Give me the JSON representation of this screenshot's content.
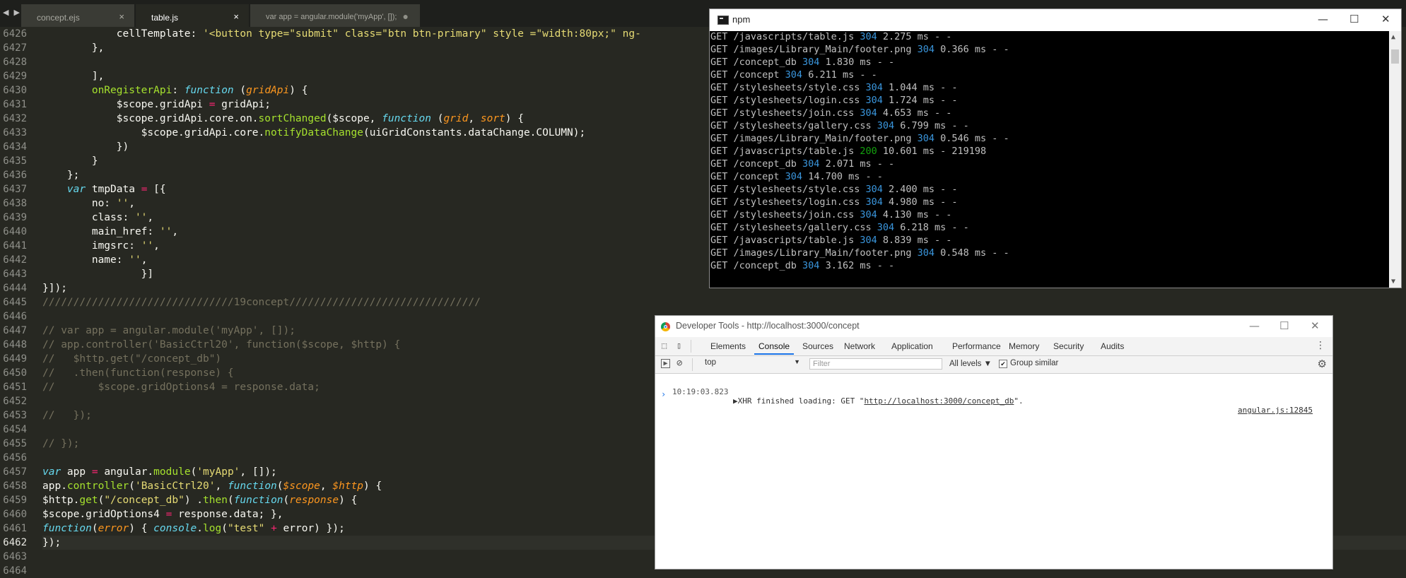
{
  "tabs": {
    "nav": "◀ ▶",
    "items": [
      {
        "label": "concept.ejs",
        "close": "×"
      },
      {
        "label": "table.js",
        "close": "×"
      },
      {
        "label": "var app = angular.module('myApp', []);",
        "close": "●"
      }
    ]
  },
  "editor": {
    "line_numbers": [
      "6426",
      "6427",
      "6428",
      "6429",
      "6430",
      "6431",
      "6432",
      "6433",
      "6434",
      "6435",
      "6436",
      "6437",
      "6438",
      "6439",
      "6440",
      "6441",
      "6442",
      "6443",
      "6444",
      "6445",
      "6446",
      "6447",
      "6448",
      "6449",
      "6450",
      "6451",
      "6452",
      "6453",
      "6454",
      "6455",
      "6456",
      "6457",
      "6458",
      "6459",
      "6460",
      "6461",
      "6462",
      "6463",
      "6464"
    ],
    "current_line": "6462",
    "lines": [
      [
        {
          "t": "            cellTemplate: ",
          "c": ""
        },
        {
          "t": "'<button type=\"submit\" class=\"btn btn-primary\" style =\"width:80px;\" ng-",
          "c": "str"
        }
      ],
      [
        {
          "t": "        },",
          "c": ""
        }
      ],
      [
        {
          "t": "",
          "c": ""
        }
      ],
      [
        {
          "t": "        ],",
          "c": ""
        }
      ],
      [
        {
          "t": "        ",
          "c": ""
        },
        {
          "t": "onRegisterApi",
          "c": "fn"
        },
        {
          "t": ": ",
          "c": ""
        },
        {
          "t": "function",
          "c": "kw"
        },
        {
          "t": " (",
          "c": ""
        },
        {
          "t": "gridApi",
          "c": "arg"
        },
        {
          "t": ") {",
          "c": ""
        }
      ],
      [
        {
          "t": "            $scope.gridApi ",
          "c": ""
        },
        {
          "t": "=",
          "c": "op"
        },
        {
          "t": " gridApi;",
          "c": ""
        }
      ],
      [
        {
          "t": "            $scope.gridApi.core.on.",
          "c": ""
        },
        {
          "t": "sortChanged",
          "c": "fn"
        },
        {
          "t": "($scope, ",
          "c": ""
        },
        {
          "t": "function",
          "c": "kw"
        },
        {
          "t": " (",
          "c": ""
        },
        {
          "t": "grid",
          "c": "arg"
        },
        {
          "t": ", ",
          "c": ""
        },
        {
          "t": "sort",
          "c": "arg"
        },
        {
          "t": ") {",
          "c": ""
        }
      ],
      [
        {
          "t": "                $scope.gridApi.core.",
          "c": ""
        },
        {
          "t": "notifyDataChange",
          "c": "fn"
        },
        {
          "t": "(uiGridConstants.dataChange.COLUMN);",
          "c": ""
        }
      ],
      [
        {
          "t": "            })",
          "c": ""
        }
      ],
      [
        {
          "t": "        }",
          "c": ""
        }
      ],
      [
        {
          "t": "    };",
          "c": ""
        }
      ],
      [
        {
          "t": "    ",
          "c": ""
        },
        {
          "t": "var",
          "c": "kw"
        },
        {
          "t": " tmpData ",
          "c": ""
        },
        {
          "t": "=",
          "c": "op"
        },
        {
          "t": " [{",
          "c": ""
        }
      ],
      [
        {
          "t": "        no: ",
          "c": ""
        },
        {
          "t": "''",
          "c": "str"
        },
        {
          "t": ",",
          "c": ""
        }
      ],
      [
        {
          "t": "        class: ",
          "c": ""
        },
        {
          "t": "''",
          "c": "str"
        },
        {
          "t": ",",
          "c": ""
        }
      ],
      [
        {
          "t": "        main_href: ",
          "c": ""
        },
        {
          "t": "''",
          "c": "str"
        },
        {
          "t": ",",
          "c": ""
        }
      ],
      [
        {
          "t": "        imgsrc: ",
          "c": ""
        },
        {
          "t": "''",
          "c": "str"
        },
        {
          "t": ",",
          "c": ""
        }
      ],
      [
        {
          "t": "        name: ",
          "c": ""
        },
        {
          "t": "''",
          "c": "str"
        },
        {
          "t": ",",
          "c": ""
        }
      ],
      [
        {
          "t": "                }]",
          "c": ""
        }
      ],
      [
        {
          "t": "}]);",
          "c": ""
        }
      ],
      [
        {
          "t": "///////////////////////////////19concept///////////////////////////////",
          "c": "com"
        }
      ],
      [
        {
          "t": "",
          "c": ""
        }
      ],
      [
        {
          "t": "// var app = angular.module('myApp', []);",
          "c": "com"
        }
      ],
      [
        {
          "t": "// app.controller('BasicCtrl20', function($scope, $http) {",
          "c": "com"
        }
      ],
      [
        {
          "t": "//   $http.get(\"/concept_db\")",
          "c": "com"
        }
      ],
      [
        {
          "t": "//   .then(function(response) {",
          "c": "com"
        }
      ],
      [
        {
          "t": "//       $scope.gridOptions4 = response.data;",
          "c": "com"
        }
      ],
      [
        {
          "t": "",
          "c": ""
        }
      ],
      [
        {
          "t": "//   });",
          "c": "com"
        }
      ],
      [
        {
          "t": "",
          "c": ""
        }
      ],
      [
        {
          "t": "// });",
          "c": "com"
        }
      ],
      [
        {
          "t": "",
          "c": ""
        }
      ],
      [
        {
          "t": "var",
          "c": "kw"
        },
        {
          "t": " app ",
          "c": ""
        },
        {
          "t": "=",
          "c": "op"
        },
        {
          "t": " angular.",
          "c": ""
        },
        {
          "t": "module",
          "c": "fn"
        },
        {
          "t": "(",
          "c": ""
        },
        {
          "t": "'myApp'",
          "c": "str"
        },
        {
          "t": ", []);",
          "c": ""
        }
      ],
      [
        {
          "t": "app.",
          "c": ""
        },
        {
          "t": "controller",
          "c": "fn"
        },
        {
          "t": "(",
          "c": ""
        },
        {
          "t": "'BasicCtrl20'",
          "c": "str"
        },
        {
          "t": ", ",
          "c": ""
        },
        {
          "t": "function",
          "c": "kw"
        },
        {
          "t": "(",
          "c": ""
        },
        {
          "t": "$scope",
          "c": "arg"
        },
        {
          "t": ", ",
          "c": ""
        },
        {
          "t": "$http",
          "c": "arg"
        },
        {
          "t": ") {",
          "c": ""
        }
      ],
      [
        {
          "t": "$http.",
          "c": ""
        },
        {
          "t": "get",
          "c": "fn"
        },
        {
          "t": "(",
          "c": ""
        },
        {
          "t": "\"/concept_db\"",
          "c": "str"
        },
        {
          "t": ") .",
          "c": ""
        },
        {
          "t": "then",
          "c": "fn"
        },
        {
          "t": "(",
          "c": ""
        },
        {
          "t": "function",
          "c": "kw"
        },
        {
          "t": "(",
          "c": ""
        },
        {
          "t": "response",
          "c": "arg"
        },
        {
          "t": ") {",
          "c": ""
        }
      ],
      [
        {
          "t": "$scope.gridOptions4 ",
          "c": ""
        },
        {
          "t": "=",
          "c": "op"
        },
        {
          "t": " response.data; },",
          "c": ""
        }
      ],
      [
        {
          "t": "function",
          "c": "kw"
        },
        {
          "t": "(",
          "c": ""
        },
        {
          "t": "error",
          "c": "arg"
        },
        {
          "t": ") { ",
          "c": ""
        },
        {
          "t": "console",
          "c": "kw"
        },
        {
          "t": ".",
          "c": ""
        },
        {
          "t": "log",
          "c": "fn"
        },
        {
          "t": "(",
          "c": ""
        },
        {
          "t": "\"test\"",
          "c": "str"
        },
        {
          "t": " ",
          "c": ""
        },
        {
          "t": "+",
          "c": "op"
        },
        {
          "t": " error) });",
          "c": ""
        }
      ],
      [
        {
          "t": "});",
          "c": ""
        }
      ],
      [
        {
          "t": "",
          "c": ""
        }
      ],
      [
        {
          "t": "",
          "c": ""
        }
      ]
    ]
  },
  "npm_window": {
    "title": "npm",
    "minimize": "—",
    "maximize": "☐",
    "close": "✕",
    "log": [
      {
        "path": "GET /javascripts/table.js ",
        "status": "304",
        "rest": " 2.275 ms - -"
      },
      {
        "path": "GET /images/Library_Main/footer.png ",
        "status": "304",
        "rest": " 0.366 ms - -"
      },
      {
        "path": "GET /concept_db ",
        "status": "304",
        "rest": " 1.830 ms - -"
      },
      {
        "path": "GET /concept ",
        "status": "304",
        "rest": " 6.211 ms - -"
      },
      {
        "path": "GET /stylesheets/style.css ",
        "status": "304",
        "rest": " 1.044 ms - -"
      },
      {
        "path": "GET /stylesheets/login.css ",
        "status": "304",
        "rest": " 1.724 ms - -"
      },
      {
        "path": "GET /stylesheets/join.css ",
        "status": "304",
        "rest": " 4.653 ms - -"
      },
      {
        "path": "GET /stylesheets/gallery.css ",
        "status": "304",
        "rest": " 6.799 ms - -"
      },
      {
        "path": "GET /images/Library_Main/footer.png ",
        "status": "304",
        "rest": " 0.546 ms - -"
      },
      {
        "path": "GET /javascripts/table.js ",
        "status": "200",
        "rest": " 10.601 ms - 219198"
      },
      {
        "path": "GET /concept_db ",
        "status": "304",
        "rest": " 2.071 ms - -"
      },
      {
        "path": "GET /concept ",
        "status": "304",
        "rest": " 14.700 ms - -"
      },
      {
        "path": "GET /stylesheets/style.css ",
        "status": "304",
        "rest": " 2.400 ms - -"
      },
      {
        "path": "GET /stylesheets/login.css ",
        "status": "304",
        "rest": " 4.980 ms - -"
      },
      {
        "path": "GET /stylesheets/join.css ",
        "status": "304",
        "rest": " 4.130 ms - -"
      },
      {
        "path": "GET /stylesheets/gallery.css ",
        "status": "304",
        "rest": " 6.218 ms - -"
      },
      {
        "path": "GET /javascripts/table.js ",
        "status": "304",
        "rest": " 8.839 ms - -"
      },
      {
        "path": "GET /images/Library_Main/footer.png ",
        "status": "304",
        "rest": " 0.548 ms - -"
      },
      {
        "path": "GET /concept_db ",
        "status": "304",
        "rest": " 3.162 ms - -"
      }
    ],
    "scroll_up": "▲",
    "scroll_down": "▼"
  },
  "devtools": {
    "title": "Developer Tools - http://localhost:3000/concept",
    "minimize": "—",
    "maximize": "☐",
    "close": "✕",
    "inspect_icon": "⬚",
    "device_icon": "▯",
    "tabs": [
      "Elements",
      "Console",
      "Sources",
      "Network",
      "Application",
      "Performance",
      "Memory",
      "Security",
      "Audits"
    ],
    "active_tab": "Console",
    "kebab": "⋮",
    "sidebar_icon": "▶",
    "clear_icon": "⊘",
    "context": "top",
    "context_arrow": "▼",
    "filter_placeholder": "Filter",
    "levels": "All levels ▼",
    "group_similar": "Group similar",
    "group_checked": "✔",
    "gear": "⚙",
    "message": {
      "timestamp": "10:19:03.823",
      "prefix": "▶XHR finished loading: GET \"",
      "url": "http://localhost:3000/concept_db",
      "suffix": "\".",
      "source": "angular.js:12845"
    },
    "prompt": "›"
  }
}
